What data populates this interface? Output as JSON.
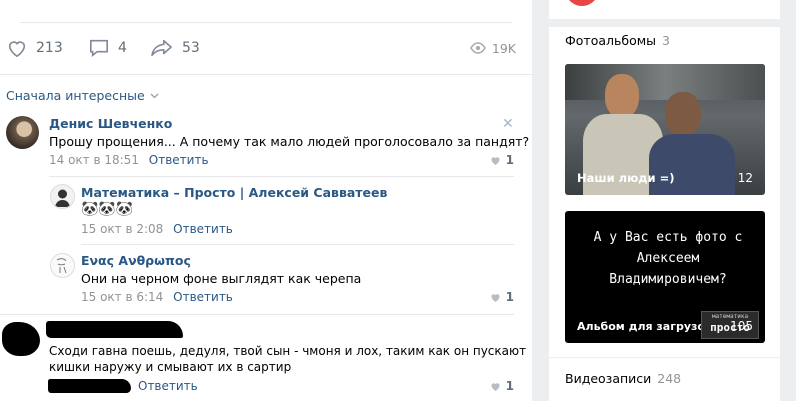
{
  "post": {
    "likes": "213",
    "comments": "4",
    "shares": "53",
    "views": "19K"
  },
  "sort_label": "Сначала интересные",
  "comments": [
    {
      "author": "Денис Шевченко",
      "text": "Прошу прощения... А почему так мало людей проголосовало за пандят?",
      "date": "14 окт в 18:51",
      "reply": "Ответить",
      "likes": "1"
    },
    {
      "author": "Математика – Просто | Алексей Савватеев",
      "text": "🐼🐼🐼",
      "date": "15 окт в 2:08",
      "reply": "Ответить"
    },
    {
      "author": "Ενας Ανθρωπος",
      "text": "Они на черном фоне выглядят как черепа",
      "date": "15 окт в 6:14",
      "reply": "Ответить",
      "likes": "1"
    },
    {
      "text_line1": "Сходи гавна поешь, дедуля, твой сын - чмоня и лох, таким как он пускают",
      "text_line2": "кишки наружу и смывают их в сартир",
      "reply": "Ответить",
      "likes": "1"
    }
  ],
  "sidebar": {
    "photo_albums": {
      "title": "Фотоальбомы",
      "count": "3"
    },
    "albums": [
      {
        "caption": "Наши люди =)",
        "count": "12"
      },
      {
        "caption": "Альбом для загрузок",
        "count": "105",
        "cover_text": "А у Вас есть фото с Алексеем Владимировичем?",
        "logo_line1": "математика",
        "logo_line2": "просто"
      }
    ],
    "videos": {
      "title": "Видеозаписи",
      "count": "248"
    }
  }
}
